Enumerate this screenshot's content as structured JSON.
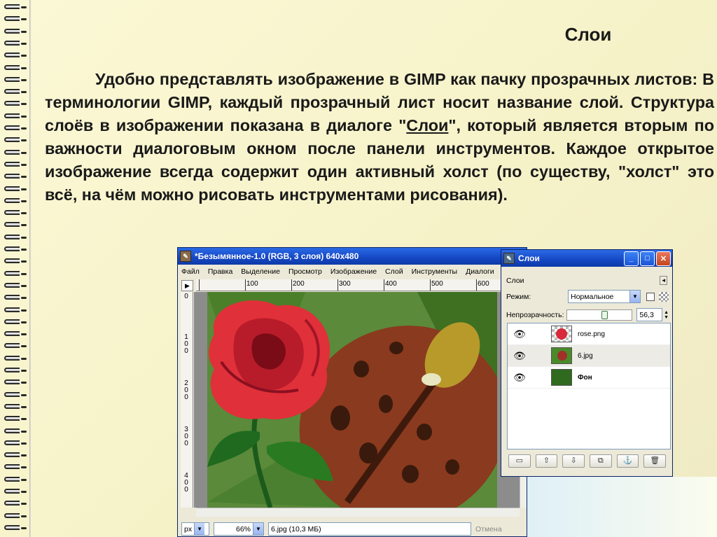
{
  "slide": {
    "title": "Слои",
    "text_before_link": "Удобно представлять изображение в GIMP как пачку прозрачных листов: В терминологии GIMP, каждый прозрачный лист носит название слой. Структура слоёв в изображении показана в диалоге \"",
    "link_text": "Слои",
    "text_after_link": "\", который является вторым по важности диалоговым окном после панели инструментов. Каждое открытое изображение всегда содержит один активный холст (по существу, \"холст\" это всё, на чём можно рисовать инструментами рисования)."
  },
  "image_window": {
    "title": "*Безымянное-1.0 (RGB, 3 слоя) 640x480",
    "menu": [
      "Файл",
      "Правка",
      "Выделение",
      "Просмотр",
      "Изображение",
      "Слой",
      "Инструменты",
      "Диалоги"
    ],
    "ruler_h": [
      "100",
      "200",
      "300",
      "400",
      "500",
      "600"
    ],
    "ruler_v": [
      "0",
      "100",
      "200",
      "300",
      "400"
    ],
    "unit": "px",
    "zoom": "66%",
    "status": "6.jpg (10,3 МБ)",
    "cancel": "Отмена"
  },
  "layers_dialog": {
    "title": "Слои",
    "header": "Слои",
    "mode_label": "Режим:",
    "mode_value": "Нормальное",
    "opacity_label": "Непрозрачность:",
    "opacity_value": "56,3",
    "opacity_fraction": 0.563,
    "layers": [
      {
        "name": "rose.png",
        "bold": false
      },
      {
        "name": "6.jpg",
        "bold": false
      },
      {
        "name": "Фон",
        "bold": true
      }
    ],
    "buttons": [
      "new-layer",
      "raise-layer",
      "lower-layer",
      "duplicate-layer",
      "anchor-layer",
      "delete-layer"
    ]
  },
  "colors": {
    "xp_title": "#1547c4",
    "rose": "#e0303a",
    "ladybug": "#8a3a1e",
    "leaf": "#4e8a2a"
  }
}
